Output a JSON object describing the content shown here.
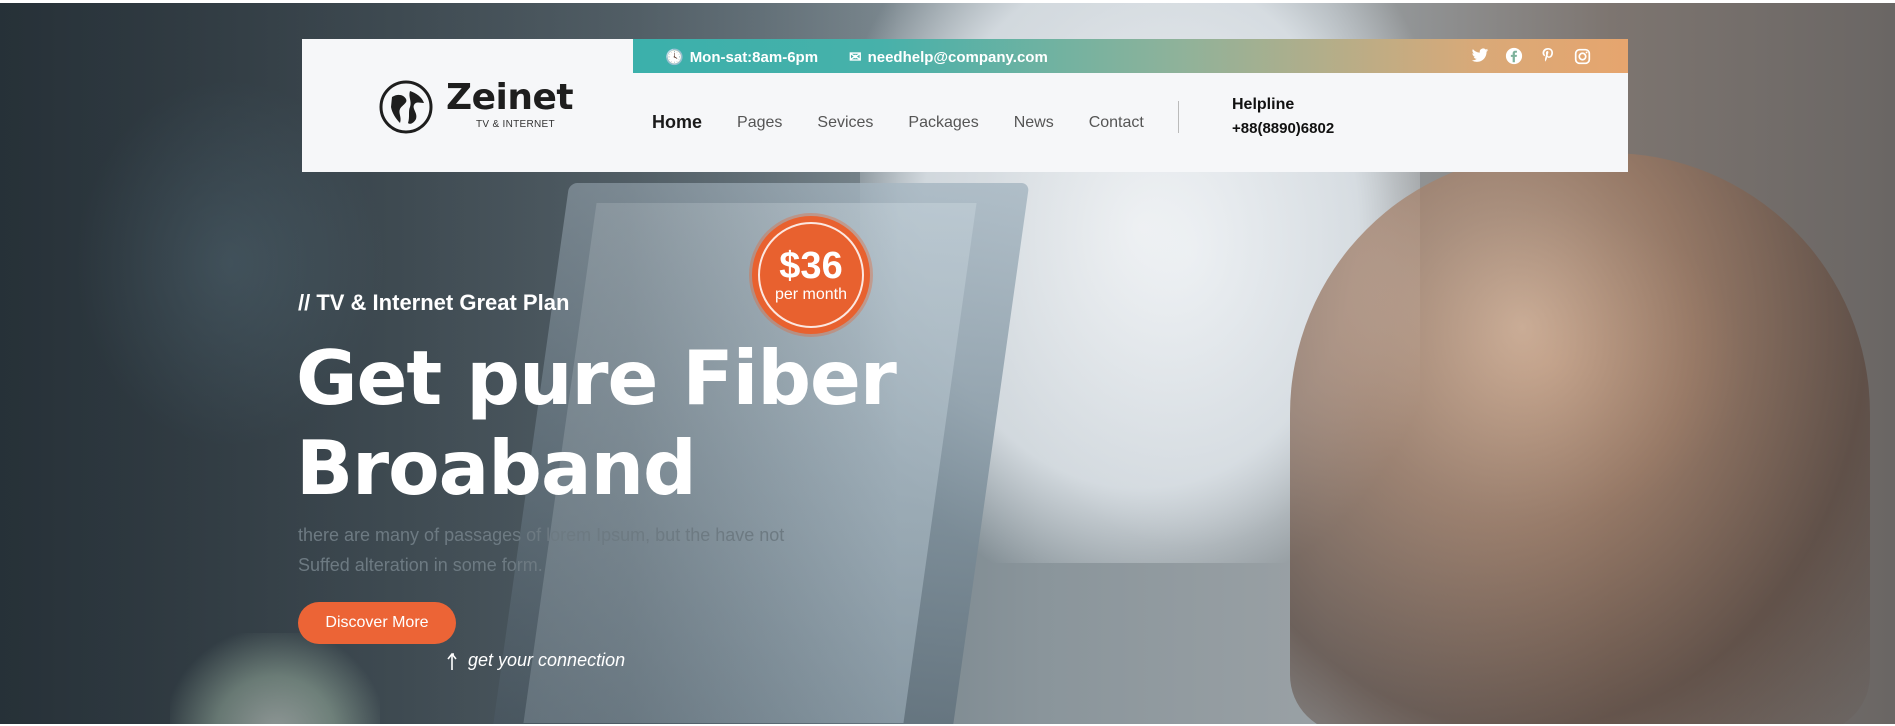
{
  "brand": {
    "name": "Zeinet",
    "tagline": "TV & INTERNET"
  },
  "topbar": {
    "hours": "Mon-sat:8am-6pm",
    "email": "needhelp@company.com",
    "social": [
      "twitter-icon",
      "facebook-icon",
      "pinterest-icon",
      "instagram-icon"
    ]
  },
  "nav": {
    "items": [
      {
        "label": "Home",
        "active": true
      },
      {
        "label": "Pages"
      },
      {
        "label": "Sevices"
      },
      {
        "label": "Packages"
      },
      {
        "label": "News"
      },
      {
        "label": "Contact"
      }
    ]
  },
  "helpline": {
    "label": "Helpline",
    "number": "+88(8890)6802"
  },
  "hero": {
    "eyebrow": "// TV & Internet Great Plan",
    "headline_line1": "Get pure Fiber",
    "headline_line2": "Broaband",
    "description_line1": "there are many of passages of lorem Ipsum, but the have not",
    "description_line2": "Suffed alteration in some form.",
    "cta_label": "Discover More",
    "cta_note": "get your connection"
  },
  "price": {
    "amount": "$36",
    "period": "per month"
  },
  "colors": {
    "accent": "#ec6436",
    "topbar_start": "#3bb0ab",
    "topbar_end": "#e6a56e"
  }
}
